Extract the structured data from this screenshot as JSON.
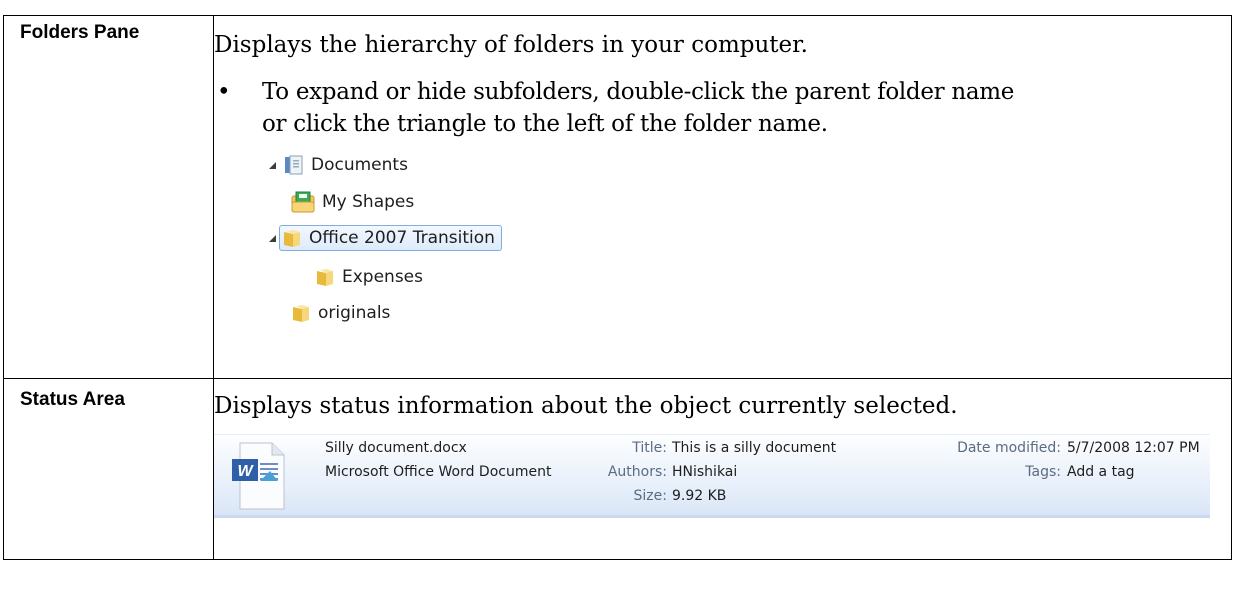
{
  "rows": [
    {
      "label": "Folders Pane",
      "description": "Displays the hierarchy of folders in your computer.",
      "bullet_line1": "To expand or hide subfolders, double-click the parent folder name",
      "bullet_line2": "or click the triangle to the left of the folder name.",
      "tree": [
        {
          "label": "Documents",
          "icon": "library-icon",
          "expanded": true
        },
        {
          "label": "My Shapes",
          "icon": "shapes-folder-icon"
        },
        {
          "label": "Office 2007 Transition",
          "icon": "folder-icon",
          "expanded": true,
          "selected": true
        },
        {
          "label": "Expenses",
          "icon": "folder-icon"
        },
        {
          "label": "originals",
          "icon": "folder-icon"
        }
      ]
    },
    {
      "label": "Status Area",
      "description": "Displays status information about the object currently selected.",
      "status": {
        "filename": "Silly document.docx",
        "filetype": "Microsoft Office Word Document",
        "title_key": "Title:",
        "title_val": "This is a silly document",
        "authors_key": "Authors:",
        "authors_val": "HNishikai",
        "size_key": "Size:",
        "size_val": "9.92 KB",
        "date_key": "Date modified:",
        "date_val": "5/7/2008 12:07 PM",
        "tags_key": "Tags:",
        "tags_val": "Add a tag"
      }
    }
  ],
  "colors": {
    "folder": "#f2cf6e",
    "selection": "#84acdd",
    "status_key": "#5b6c80"
  }
}
